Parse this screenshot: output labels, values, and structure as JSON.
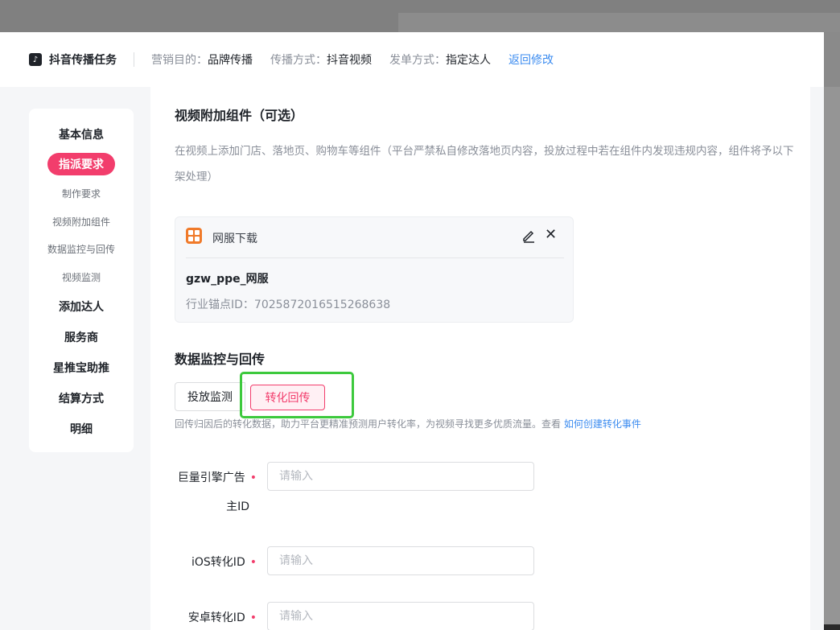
{
  "header": {
    "brand_icon": "♪",
    "brand_title": "抖音传播任务",
    "meta": [
      {
        "label": "营销目的：",
        "value": "品牌传播"
      },
      {
        "label": "传播方式：",
        "value": "抖音视频"
      },
      {
        "label": "发单方式：",
        "value": "指定达人"
      }
    ],
    "back_link": "返回修改"
  },
  "sidenav": {
    "items": [
      {
        "label": "基本信息"
      },
      {
        "label": "指派要求"
      },
      {
        "label": "制作要求"
      },
      {
        "label": "视频附加组件"
      },
      {
        "label": "数据监控与回传"
      },
      {
        "label": "视频监测"
      },
      {
        "label": "添加达人"
      },
      {
        "label": "服务商"
      },
      {
        "label": "星推宝助推"
      },
      {
        "label": "结算方式"
      },
      {
        "label": "明细"
      }
    ]
  },
  "attachment": {
    "title": "视频附加组件（可选）",
    "desc": "在视频上添加门店、落地页、购物车等组件（平台严禁私自修改落地页内容，投放过程中若在组件内发现违规内容，组件将予以下架处理）",
    "card": {
      "type": "网服下载",
      "name": "gzw_ppe_网服",
      "id_label": "行业锚点ID：7025872016515268638",
      "icon": "app-grid-icon"
    }
  },
  "monitoring": {
    "title": "数据监控与回传",
    "tabs": [
      "投放监测",
      "转化回传"
    ],
    "hint": "回传归因后的转化数据，助力平台更精准预测用户转化率，为视频寻找更多优质流量。查看",
    "hint_link": "如何创建转化事件",
    "fields": [
      {
        "label_line1": "巨量引擎广告",
        "label_line2": "主ID",
        "placeholder": "请输入"
      },
      {
        "label": "iOS转化ID",
        "placeholder": "请输入"
      },
      {
        "label": "安卓转化ID",
        "placeholder": "请输入"
      }
    ],
    "required_mark": "•"
  },
  "colors": {
    "accent": "#f23d6c",
    "link": "#3c8cf0",
    "highlight": "#3dc93d"
  }
}
